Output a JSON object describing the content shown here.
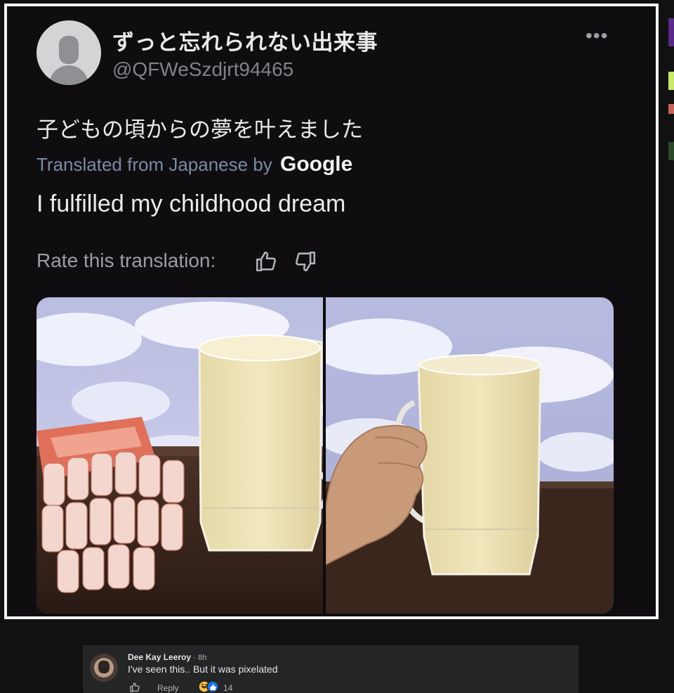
{
  "tweet": {
    "display_name": "ずっと忘れられない出来事",
    "handle": "@QFWeSzdjrt94465",
    "more_icon": "more-horizontal-icon",
    "original_text": "子どもの頃からの夢を叶えました",
    "translated_from": "Translated from Japanese by",
    "translator": "Google",
    "translation": "I fulfilled my childhood dream",
    "rate_label": "Rate this translation:"
  },
  "comment": {
    "author": "Dee Kay Leeroy",
    "time": "· 8h",
    "text": "I've seen this.. But it was pixelated",
    "reply_label": "Reply",
    "reaction_count": "14",
    "colors": {
      "background": "#242526",
      "text": "#e4e6eb",
      "secondary": "#b0b3b8"
    }
  },
  "colors": {
    "frame_border": "#f4f4f4",
    "tweet_background": "#0f0d0f",
    "page_background": "#111112"
  }
}
